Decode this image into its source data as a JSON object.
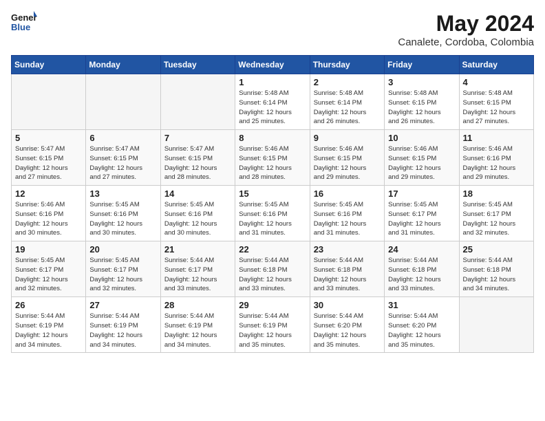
{
  "header": {
    "logo_line1": "General",
    "logo_line2": "Blue",
    "month_year": "May 2024",
    "location": "Canalete, Cordoba, Colombia"
  },
  "days_of_week": [
    "Sunday",
    "Monday",
    "Tuesday",
    "Wednesday",
    "Thursday",
    "Friday",
    "Saturday"
  ],
  "weeks": [
    [
      {
        "day": "",
        "info": ""
      },
      {
        "day": "",
        "info": ""
      },
      {
        "day": "",
        "info": ""
      },
      {
        "day": "1",
        "info": "Sunrise: 5:48 AM\nSunset: 6:14 PM\nDaylight: 12 hours\nand 25 minutes."
      },
      {
        "day": "2",
        "info": "Sunrise: 5:48 AM\nSunset: 6:14 PM\nDaylight: 12 hours\nand 26 minutes."
      },
      {
        "day": "3",
        "info": "Sunrise: 5:48 AM\nSunset: 6:15 PM\nDaylight: 12 hours\nand 26 minutes."
      },
      {
        "day": "4",
        "info": "Sunrise: 5:48 AM\nSunset: 6:15 PM\nDaylight: 12 hours\nand 27 minutes."
      }
    ],
    [
      {
        "day": "5",
        "info": "Sunrise: 5:47 AM\nSunset: 6:15 PM\nDaylight: 12 hours\nand 27 minutes."
      },
      {
        "day": "6",
        "info": "Sunrise: 5:47 AM\nSunset: 6:15 PM\nDaylight: 12 hours\nand 27 minutes."
      },
      {
        "day": "7",
        "info": "Sunrise: 5:47 AM\nSunset: 6:15 PM\nDaylight: 12 hours\nand 28 minutes."
      },
      {
        "day": "8",
        "info": "Sunrise: 5:46 AM\nSunset: 6:15 PM\nDaylight: 12 hours\nand 28 minutes."
      },
      {
        "day": "9",
        "info": "Sunrise: 5:46 AM\nSunset: 6:15 PM\nDaylight: 12 hours\nand 29 minutes."
      },
      {
        "day": "10",
        "info": "Sunrise: 5:46 AM\nSunset: 6:15 PM\nDaylight: 12 hours\nand 29 minutes."
      },
      {
        "day": "11",
        "info": "Sunrise: 5:46 AM\nSunset: 6:16 PM\nDaylight: 12 hours\nand 29 minutes."
      }
    ],
    [
      {
        "day": "12",
        "info": "Sunrise: 5:46 AM\nSunset: 6:16 PM\nDaylight: 12 hours\nand 30 minutes."
      },
      {
        "day": "13",
        "info": "Sunrise: 5:45 AM\nSunset: 6:16 PM\nDaylight: 12 hours\nand 30 minutes."
      },
      {
        "day": "14",
        "info": "Sunrise: 5:45 AM\nSunset: 6:16 PM\nDaylight: 12 hours\nand 30 minutes."
      },
      {
        "day": "15",
        "info": "Sunrise: 5:45 AM\nSunset: 6:16 PM\nDaylight: 12 hours\nand 31 minutes."
      },
      {
        "day": "16",
        "info": "Sunrise: 5:45 AM\nSunset: 6:16 PM\nDaylight: 12 hours\nand 31 minutes."
      },
      {
        "day": "17",
        "info": "Sunrise: 5:45 AM\nSunset: 6:17 PM\nDaylight: 12 hours\nand 31 minutes."
      },
      {
        "day": "18",
        "info": "Sunrise: 5:45 AM\nSunset: 6:17 PM\nDaylight: 12 hours\nand 32 minutes."
      }
    ],
    [
      {
        "day": "19",
        "info": "Sunrise: 5:45 AM\nSunset: 6:17 PM\nDaylight: 12 hours\nand 32 minutes."
      },
      {
        "day": "20",
        "info": "Sunrise: 5:45 AM\nSunset: 6:17 PM\nDaylight: 12 hours\nand 32 minutes."
      },
      {
        "day": "21",
        "info": "Sunrise: 5:44 AM\nSunset: 6:17 PM\nDaylight: 12 hours\nand 33 minutes."
      },
      {
        "day": "22",
        "info": "Sunrise: 5:44 AM\nSunset: 6:18 PM\nDaylight: 12 hours\nand 33 minutes."
      },
      {
        "day": "23",
        "info": "Sunrise: 5:44 AM\nSunset: 6:18 PM\nDaylight: 12 hours\nand 33 minutes."
      },
      {
        "day": "24",
        "info": "Sunrise: 5:44 AM\nSunset: 6:18 PM\nDaylight: 12 hours\nand 33 minutes."
      },
      {
        "day": "25",
        "info": "Sunrise: 5:44 AM\nSunset: 6:18 PM\nDaylight: 12 hours\nand 34 minutes."
      }
    ],
    [
      {
        "day": "26",
        "info": "Sunrise: 5:44 AM\nSunset: 6:19 PM\nDaylight: 12 hours\nand 34 minutes."
      },
      {
        "day": "27",
        "info": "Sunrise: 5:44 AM\nSunset: 6:19 PM\nDaylight: 12 hours\nand 34 minutes."
      },
      {
        "day": "28",
        "info": "Sunrise: 5:44 AM\nSunset: 6:19 PM\nDaylight: 12 hours\nand 34 minutes."
      },
      {
        "day": "29",
        "info": "Sunrise: 5:44 AM\nSunset: 6:19 PM\nDaylight: 12 hours\nand 35 minutes."
      },
      {
        "day": "30",
        "info": "Sunrise: 5:44 AM\nSunset: 6:20 PM\nDaylight: 12 hours\nand 35 minutes."
      },
      {
        "day": "31",
        "info": "Sunrise: 5:44 AM\nSunset: 6:20 PM\nDaylight: 12 hours\nand 35 minutes."
      },
      {
        "day": "",
        "info": ""
      }
    ]
  ]
}
